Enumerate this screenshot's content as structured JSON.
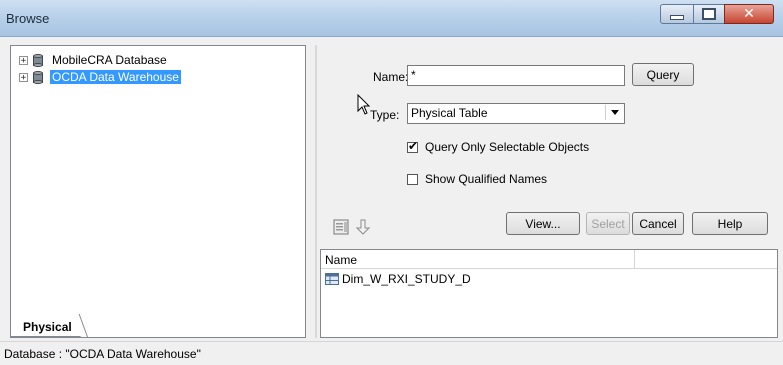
{
  "window": {
    "title": "Browse"
  },
  "tree": {
    "items": [
      {
        "label": "MobileCRA Database",
        "expander": "+"
      },
      {
        "label": "OCDA Data Warehouse",
        "expander": "+"
      }
    ],
    "tab_label": "Physical"
  },
  "form": {
    "name_label": "Name:",
    "name_value": "*",
    "query_button": "Query",
    "type_label": "Type:",
    "type_value": "Physical Table",
    "query_only_selectable": {
      "label": "Query Only Selectable Objects",
      "checked": true
    },
    "show_qualified": {
      "label": "Show Qualified Names",
      "checked": false
    }
  },
  "buttons": {
    "view": "View...",
    "select": "Select",
    "cancel": "Cancel",
    "help": "Help"
  },
  "results": {
    "columns": [
      "Name",
      ""
    ],
    "rows": [
      {
        "name": "Dim_W_RXI_STUDY_D"
      }
    ]
  },
  "status": {
    "text": "Database : \"OCDA Data Warehouse\""
  },
  "icons": {
    "minimize": "minimize-icon",
    "maximize": "maximize-icon",
    "close": "close-icon",
    "database": "database-icon",
    "table": "table-icon",
    "properties": "properties-icon",
    "down": "arrow-down-icon"
  }
}
